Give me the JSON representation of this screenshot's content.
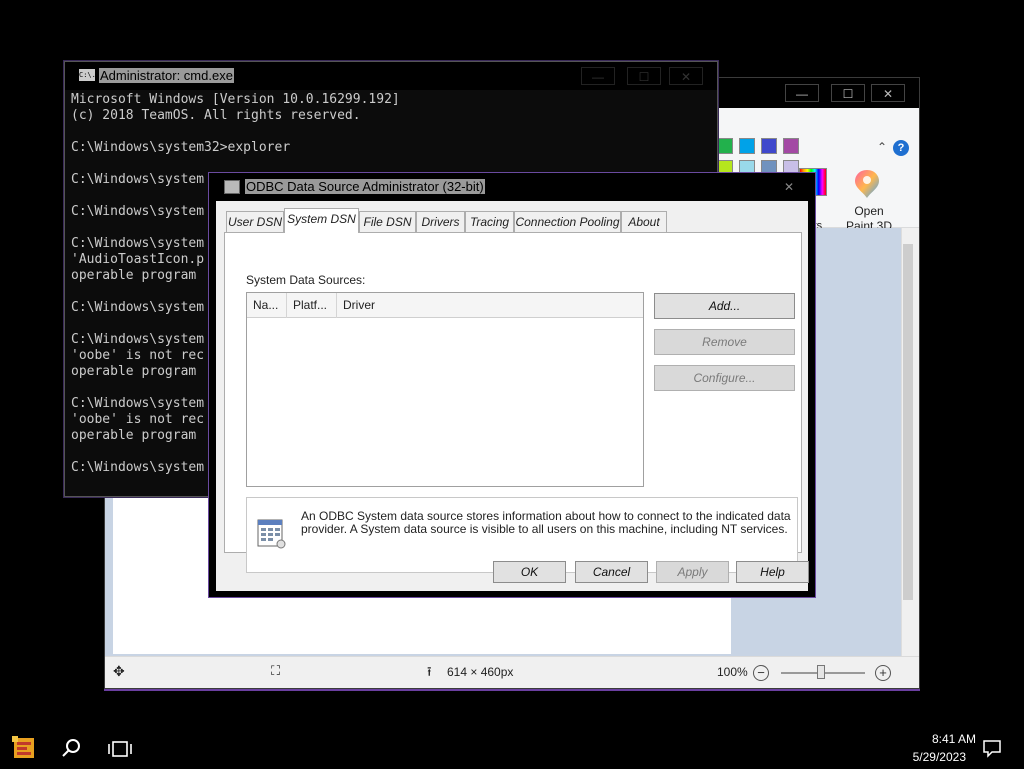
{
  "paint": {
    "close_glyph": "✕",
    "minimize_glyph": "—",
    "maximize_glyph": "☐",
    "help_glyph": "?",
    "collapse_glyph": "⌃",
    "edit_colors_label_partial": "t\nrs",
    "paint3d_label": "Open\nPaint 3D",
    "status": {
      "move_glyph": "✥",
      "select_glyph": "⛶",
      "size_glyph": "⭱",
      "size_text": "614 × 460px",
      "zoom_text": "100%",
      "zoom_out_glyph": "−",
      "zoom_in_glyph": "+"
    },
    "swatch_colors": [
      "#22b14c",
      "#00a2e8",
      "#3f48cc",
      "#a349a4",
      "#b5e61d",
      "#99d9ea",
      "#7092be",
      "#c8bfe7"
    ]
  },
  "cmd": {
    "title": "Administrator: cmd.exe",
    "icon_text": "C:\\.",
    "lines": [
      "Microsoft Windows [Version 10.0.16299.192]",
      "(c) 2018 TeamOS. All rights reserved.",
      "",
      "C:\\Windows\\system32>explorer",
      "",
      "C:\\Windows\\system",
      "",
      "C:\\Windows\\system",
      "",
      "C:\\Windows\\system",
      "'AudioToastIcon.p",
      "operable program ",
      "",
      "C:\\Windows\\system",
      "",
      "C:\\Windows\\system",
      "'oobe' is not rec",
      "operable program ",
      "",
      "C:\\Windows\\system",
      "'oobe' is not rec",
      "operable program ",
      "",
      "C:\\Windows\\system"
    ]
  },
  "odbc": {
    "title": "ODBC Data Source Administrator (32-bit)",
    "close_glyph": "✕",
    "tabs": [
      "User DSN",
      "System DSN",
      "File DSN",
      "Drivers",
      "Tracing",
      "Connection Pooling",
      "About"
    ],
    "active_tab": "System DSN",
    "sources_label": "System Data Sources:",
    "columns": [
      "Na...",
      "Platf...",
      "Driver"
    ],
    "buttons": {
      "add": "Add...",
      "remove": "Remove",
      "configure": "Configure...",
      "ok": "OK",
      "cancel": "Cancel",
      "apply": "Apply",
      "help": "Help"
    },
    "info_text": "An ODBC System data source stores information about how to connect to the indicated data provider.   A System data source is visible to all users on this machine, including NT services."
  },
  "taskbar": {
    "time": "8:41 AM",
    "date": "5/29/2023"
  }
}
